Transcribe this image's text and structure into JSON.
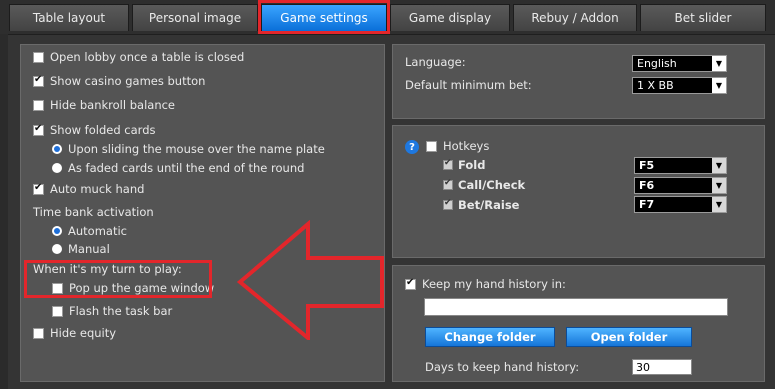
{
  "tabs": [
    {
      "label": "Table layout",
      "active": false
    },
    {
      "label": "Personal image",
      "active": false
    },
    {
      "label": "Game settings",
      "active": true
    },
    {
      "label": "Game display",
      "active": false
    },
    {
      "label": "Rebuy / Addon",
      "active": false
    },
    {
      "label": "Bet slider",
      "active": false
    }
  ],
  "left": {
    "open_lobby": {
      "label": "Open lobby once a table is closed",
      "checked": false
    },
    "show_casino": {
      "label": "Show casino games button",
      "checked": true
    },
    "hide_bankroll": {
      "label": "Hide bankroll balance",
      "checked": false
    },
    "show_folded": {
      "label": "Show folded cards",
      "checked": true
    },
    "folded_opt1": {
      "label": "Upon sliding the mouse over the name plate",
      "selected": true
    },
    "folded_opt2": {
      "label": "As faded cards until the end of the round",
      "selected": false
    },
    "auto_muck": {
      "label": "Auto muck hand",
      "checked": true
    },
    "time_bank_heading": "Time bank activation",
    "time_bank_auto": {
      "label": "Automatic",
      "selected": true
    },
    "time_bank_manual": {
      "label": "Manual",
      "selected": false
    },
    "turn_heading": "When it's my turn to play:",
    "popup_window": {
      "label": "Pop up the game window",
      "checked": false
    },
    "flash_taskbar": {
      "label": "Flash the task bar",
      "checked": false
    },
    "hide_equity": {
      "label": "Hide equity",
      "checked": false
    }
  },
  "language": {
    "label": "Language:",
    "value": "English",
    "min_bet_label": "Default minimum bet:",
    "min_bet_value": "1 X BB"
  },
  "hotkeys": {
    "label": "Hotkeys",
    "checked": false,
    "items": [
      {
        "label": "Fold",
        "key": "F5"
      },
      {
        "label": "Call/Check",
        "key": "F6"
      },
      {
        "label": "Bet/Raise",
        "key": "F7"
      }
    ]
  },
  "history": {
    "label": "Keep my hand history in:",
    "checked": true,
    "path": "",
    "change_folder": "Change folder",
    "open_folder": "Open folder",
    "days_label": "Days to keep hand history:",
    "days_value": "30"
  },
  "colors": {
    "accent": "#1e78e0",
    "highlight": "#e3262b"
  }
}
